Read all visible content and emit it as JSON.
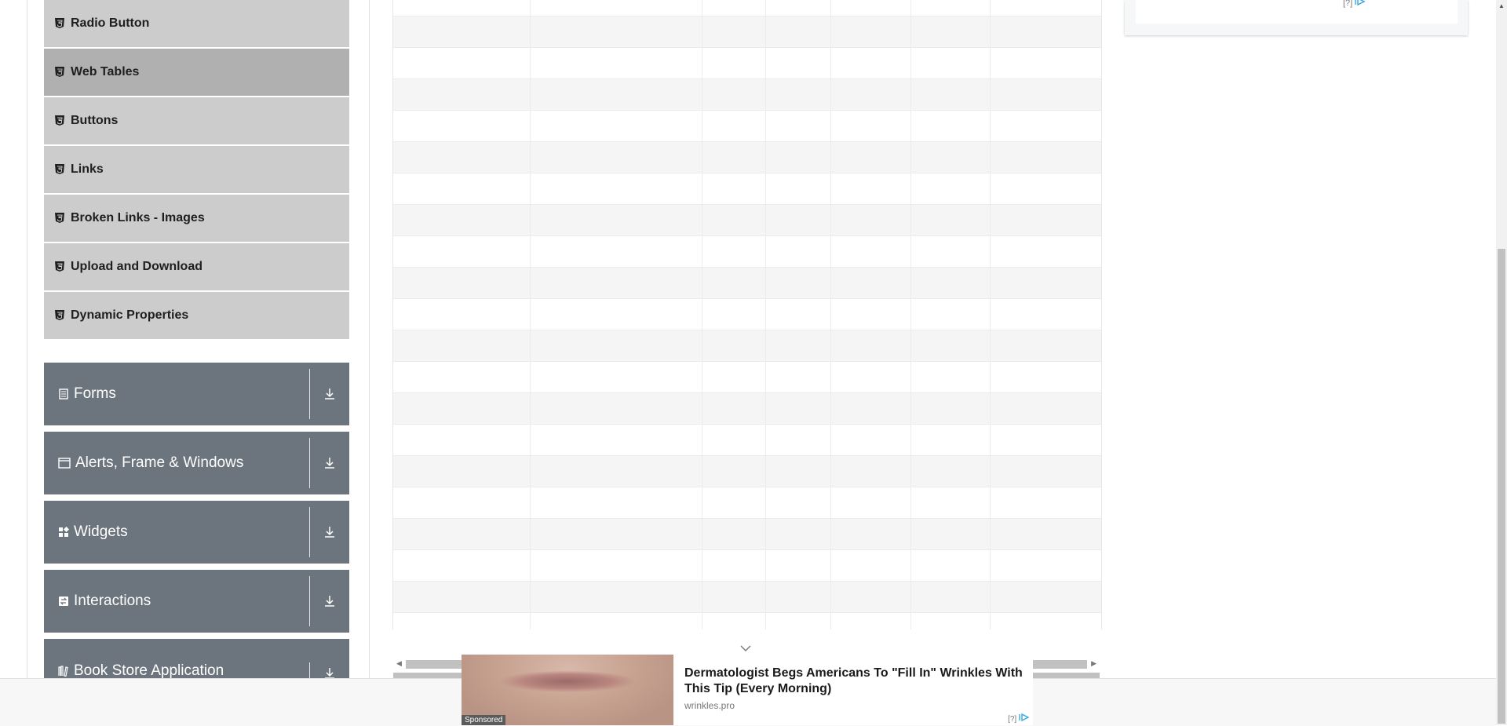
{
  "sidebar": {
    "elements_items": [
      {
        "label": "Radio Button",
        "active": false
      },
      {
        "label": "Web Tables",
        "active": true
      },
      {
        "label": "Buttons",
        "active": false
      },
      {
        "label": "Links",
        "active": false
      },
      {
        "label": "Broken Links - Images",
        "active": false
      },
      {
        "label": "Upload and Download",
        "active": false
      },
      {
        "label": "Dynamic Properties",
        "active": false
      }
    ],
    "groups": [
      {
        "label": "Forms",
        "icon": "form-icon"
      },
      {
        "label": "Alerts, Frame & Windows",
        "icon": "window-icon"
      },
      {
        "label": "Widgets",
        "icon": "widgets-icon"
      },
      {
        "label": "Interactions",
        "icon": "interactions-icon"
      },
      {
        "label": "Book Store Application",
        "icon": "books-icon"
      }
    ]
  },
  "ad": {
    "sponsored": "Sponsored",
    "headline": "Dermatologist Begs Americans To \"Fill In\" Wrinkles With This Tip (Every Morning)",
    "domain": "wrinkles.pro",
    "info": "[?]",
    "right_info": "[?]"
  },
  "colors": {
    "group_bg": "#6c757d",
    "submenu_bg": "#cccccc",
    "submenu_active_bg": "#b0b0b0"
  }
}
